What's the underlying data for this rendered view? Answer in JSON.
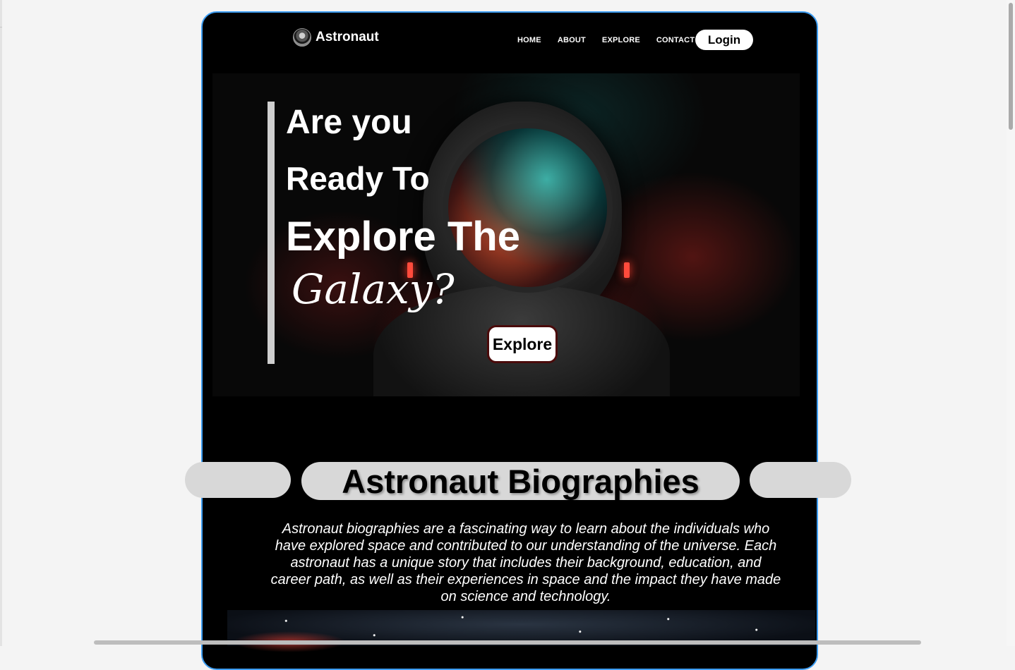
{
  "nav": {
    "brand": "Astronaut",
    "links": [
      "HOME",
      "ABOUT",
      "EXPLORE",
      "CONTACT"
    ],
    "login_label": "Login"
  },
  "hero": {
    "lines": [
      "Are you",
      "Ready To",
      "Explore The",
      "Galaxy?"
    ],
    "explore_label": "Explore"
  },
  "biographies": {
    "title": "Astronaut Biographies",
    "description": "Astronaut biographies are a fascinating way to learn about the individuals who have explored space and contributed to our understanding of the universe. Each astronaut has a unique story that includes their background, education, and career path, as well as their experiences in space and the impact they have made on science and technology.",
    "next_heading_partial": "..."
  },
  "colors": {
    "page_bg": "#f4f4f4",
    "frame_bg": "#000000",
    "frame_border": "#3d9df2",
    "pill_bg": "#d8d8d8"
  }
}
